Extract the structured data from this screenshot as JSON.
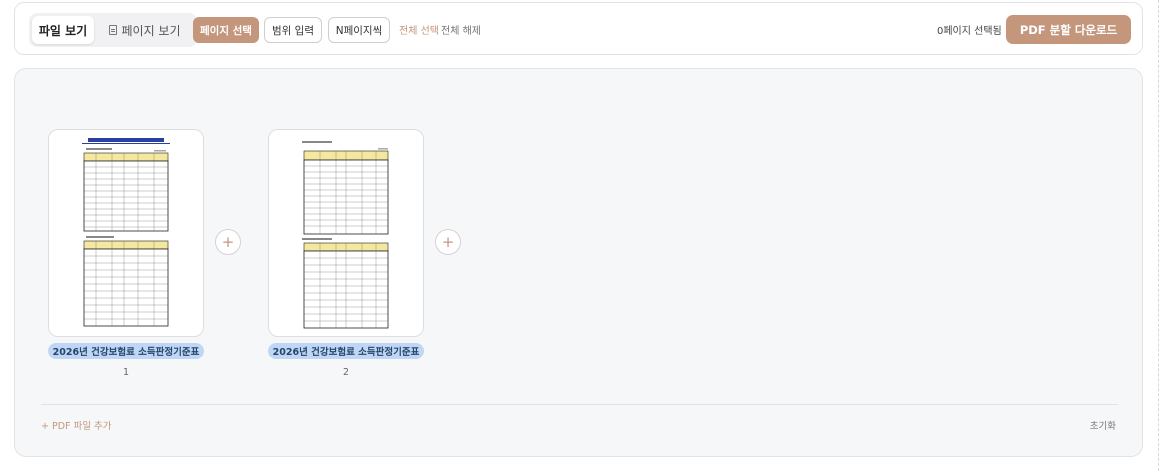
{
  "toolbar": {
    "view_toggle": {
      "file_view": "파일 보기",
      "page_view": "페이지 보기"
    },
    "modes": {
      "select": "페이지 선택",
      "range": "범위 입력",
      "nth": "N페이지씩"
    },
    "select_all": "전체 선택",
    "deselect_all": "전체 해제",
    "selected_count": "0페이지 선택됨",
    "download": "PDF 분할 다운로드"
  },
  "pages": [
    {
      "file_name": "2026년 건강보험료 소득판정기준표",
      "number": "1"
    },
    {
      "file_name": "2026년 건강보험료 소득판정기준표",
      "number": "2"
    }
  ],
  "footer": {
    "add_pdf": "+ PDF 파일 추가",
    "reset": "초기화"
  },
  "insert_symbol": "+",
  "colors": {
    "accent": "#c4967c",
    "badge_bg": "#bfd7f5",
    "badge_text": "#23456e",
    "workspace_bg": "#f6f7f9"
  }
}
